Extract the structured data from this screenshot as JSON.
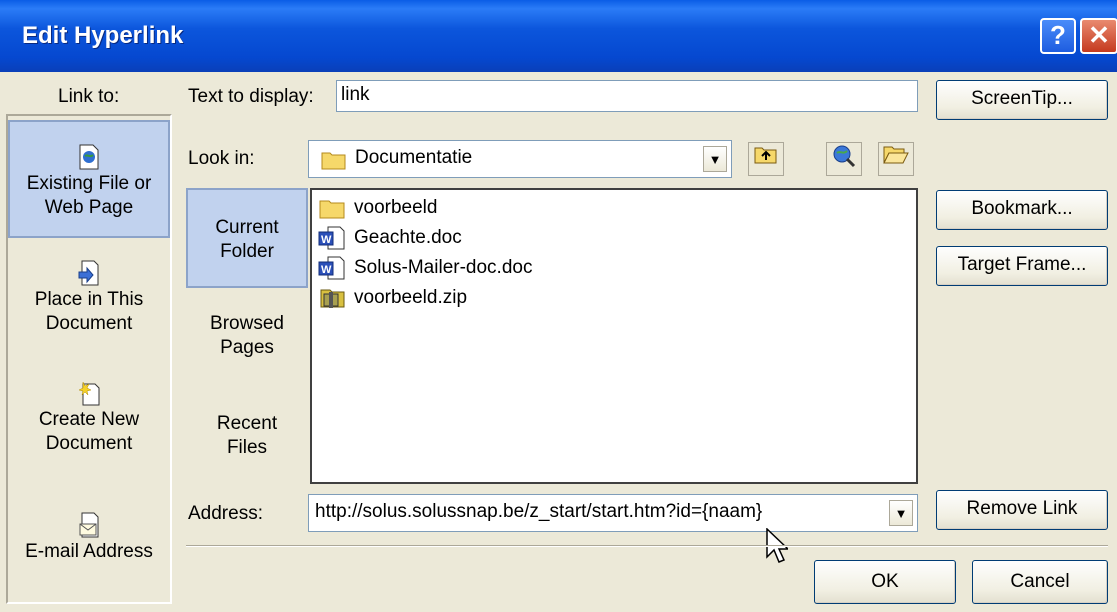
{
  "window": {
    "title": "Edit Hyperlink",
    "help_glyph": "?",
    "close_glyph": "✕"
  },
  "link_to": {
    "label": "Link to:",
    "items": [
      {
        "line1": "Existing File or",
        "line2": "Web Page",
        "icon": "web-page-file-icon",
        "selected": true
      },
      {
        "line1": "Place in This",
        "line2": "Document",
        "icon": "place-in-document-icon",
        "selected": false
      },
      {
        "line1": "Create New",
        "line2": "Document",
        "icon": "new-document-icon",
        "selected": false
      },
      {
        "line1": "E-mail Address",
        "line2": "",
        "icon": "email-icon",
        "selected": false
      }
    ]
  },
  "text_to_display": {
    "label": "Text to display:",
    "value": "link"
  },
  "screentip_button": "ScreenTip...",
  "look_in": {
    "label": "Look in:",
    "value": "Documentatie",
    "folder_icon": "folder-icon"
  },
  "places": [
    {
      "line1": "Current",
      "line2": "Folder",
      "selected": true
    },
    {
      "line1": "Browsed",
      "line2": "Pages",
      "selected": false
    },
    {
      "line1": "Recent",
      "line2": "Files",
      "selected": false
    }
  ],
  "files": [
    {
      "name": "voorbeeld",
      "icon": "folder-icon"
    },
    {
      "name": "Geachte.doc",
      "icon": "word-document-icon"
    },
    {
      "name": "Solus-Mailer-doc.doc",
      "icon": "word-document-icon"
    },
    {
      "name": "voorbeeld.zip",
      "icon": "zip-archive-icon"
    }
  ],
  "right_buttons": {
    "bookmark": "Bookmark...",
    "target_frame": "Target Frame...",
    "remove_link": "Remove Link"
  },
  "address": {
    "label": "Address:",
    "value": "http://solus.solussnap.be/z_start/start.htm?id={naam}"
  },
  "ok_button": "OK",
  "cancel_button": "Cancel",
  "colors": {
    "titlebar": "#0548d0",
    "dialog_bg": "#ece9d8",
    "selection": "#c1d2ee"
  }
}
